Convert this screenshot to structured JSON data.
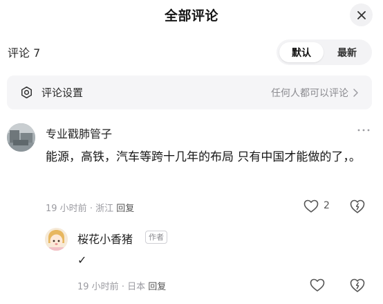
{
  "header": {
    "title": "全部评论",
    "close_icon": "close-icon"
  },
  "comments_bar": {
    "count_label": "评论 7",
    "sort_options": [
      {
        "label": "默认",
        "active": true
      },
      {
        "label": "最新",
        "active": false
      }
    ]
  },
  "settings": {
    "label": "评论设置",
    "value": "任何人都可以评论",
    "icon": "settings-icon",
    "chevron_icon": "chevron-right-icon"
  },
  "comment": {
    "username": "专业戳肺管子",
    "text": "能源，高铁，汽车等跨十几年的布局 只有中国才能做的了，。",
    "time": "19 小时前",
    "location": "浙江",
    "reply_label": "回复",
    "like_count": "2",
    "more_icon": "more-icon"
  },
  "reply": {
    "username": "桜花小香猪",
    "badge": "作者",
    "text": "✓",
    "time": "19 小时前",
    "location": "日本",
    "reply_label": "回复"
  },
  "colors": {
    "meta": "#9a9aa0",
    "surface": "#f5f5f7",
    "text": "#161616"
  }
}
